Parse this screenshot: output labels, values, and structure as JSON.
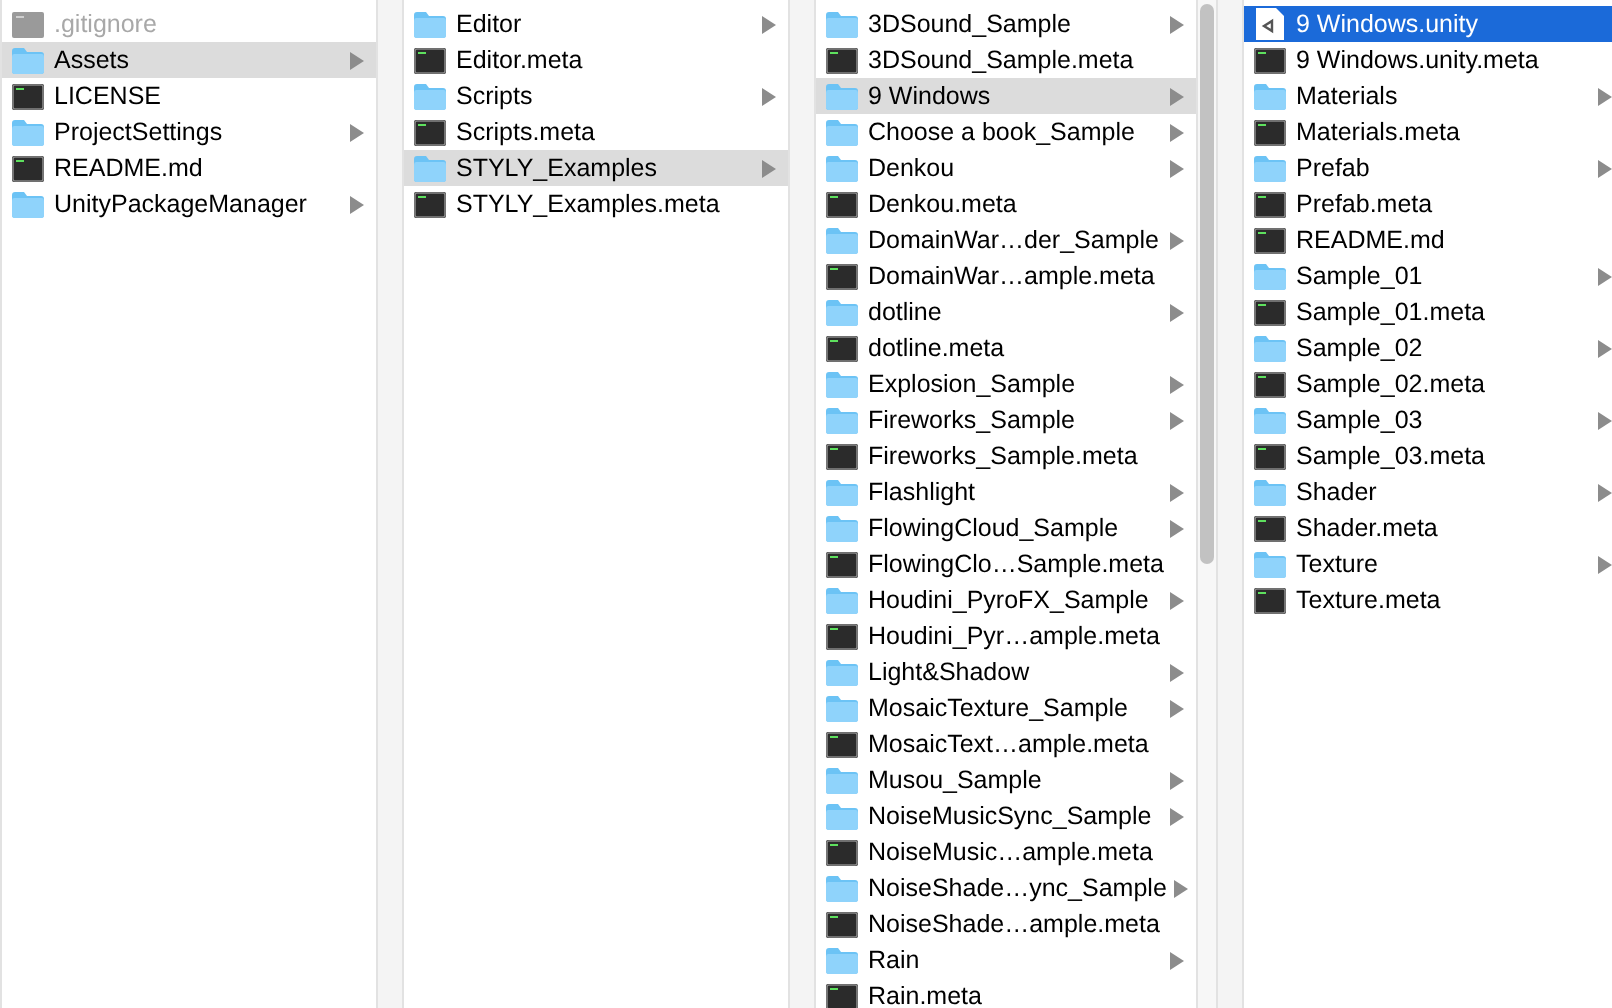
{
  "columns": [
    {
      "focused": false,
      "items": [
        {
          "name": ".gitignore",
          "kind": "hidden",
          "selected": false
        },
        {
          "name": "Assets",
          "kind": "folder",
          "selected": true
        },
        {
          "name": "LICENSE",
          "kind": "document",
          "selected": false
        },
        {
          "name": "ProjectSettings",
          "kind": "folder",
          "selected": false
        },
        {
          "name": "README.md",
          "kind": "document",
          "selected": false
        },
        {
          "name": "UnityPackageManager",
          "kind": "folder",
          "selected": false
        }
      ]
    },
    {
      "focused": false,
      "items": [
        {
          "name": "Editor",
          "kind": "folder",
          "selected": false
        },
        {
          "name": "Editor.meta",
          "kind": "document",
          "selected": false
        },
        {
          "name": "Scripts",
          "kind": "folder",
          "selected": false
        },
        {
          "name": "Scripts.meta",
          "kind": "document",
          "selected": false
        },
        {
          "name": "STYLY_Examples",
          "kind": "folder",
          "selected": true
        },
        {
          "name": "STYLY_Examples.meta",
          "kind": "document",
          "selected": false
        }
      ]
    },
    {
      "focused": false,
      "items": [
        {
          "name": "3DSound_Sample",
          "kind": "folder",
          "selected": false
        },
        {
          "name": "3DSound_Sample.meta",
          "kind": "document",
          "selected": false
        },
        {
          "name": "9 Windows",
          "kind": "folder",
          "selected": true
        },
        {
          "name": "Choose a book_Sample",
          "kind": "folder",
          "selected": false
        },
        {
          "name": "Denkou",
          "kind": "folder",
          "selected": false
        },
        {
          "name": "Denkou.meta",
          "kind": "document",
          "selected": false
        },
        {
          "name": "DomainWar…der_Sample",
          "kind": "folder",
          "selected": false
        },
        {
          "name": "DomainWar…ample.meta",
          "kind": "document",
          "selected": false
        },
        {
          "name": "dotline",
          "kind": "folder",
          "selected": false
        },
        {
          "name": "dotline.meta",
          "kind": "document",
          "selected": false
        },
        {
          "name": "Explosion_Sample",
          "kind": "folder",
          "selected": false
        },
        {
          "name": "Fireworks_Sample",
          "kind": "folder",
          "selected": false
        },
        {
          "name": "Fireworks_Sample.meta",
          "kind": "document",
          "selected": false
        },
        {
          "name": "Flashlight",
          "kind": "folder",
          "selected": false
        },
        {
          "name": "FlowingCloud_Sample",
          "kind": "folder",
          "selected": false
        },
        {
          "name": "FlowingClo…Sample.meta",
          "kind": "document",
          "selected": false
        },
        {
          "name": "Houdini_PyroFX_Sample",
          "kind": "folder",
          "selected": false
        },
        {
          "name": "Houdini_Pyr…ample.meta",
          "kind": "document",
          "selected": false
        },
        {
          "name": "Light&Shadow",
          "kind": "folder",
          "selected": false
        },
        {
          "name": "MosaicTexture_Sample",
          "kind": "folder",
          "selected": false
        },
        {
          "name": "MosaicText…ample.meta",
          "kind": "document",
          "selected": false
        },
        {
          "name": "Musou_Sample",
          "kind": "folder",
          "selected": false
        },
        {
          "name": "NoiseMusicSync_Sample",
          "kind": "folder",
          "selected": false
        },
        {
          "name": "NoiseMusic…ample.meta",
          "kind": "document",
          "selected": false
        },
        {
          "name": "NoiseShade…ync_Sample",
          "kind": "folder",
          "selected": false
        },
        {
          "name": "NoiseShade…ample.meta",
          "kind": "document",
          "selected": false
        },
        {
          "name": "Rain",
          "kind": "folder",
          "selected": false
        },
        {
          "name": "Rain.meta",
          "kind": "document",
          "selected": false
        }
      ]
    },
    {
      "focused": true,
      "items": [
        {
          "name": "9 Windows.unity",
          "kind": "unity",
          "selected": true
        },
        {
          "name": "9 Windows.unity.meta",
          "kind": "document",
          "selected": false
        },
        {
          "name": "Materials",
          "kind": "folder",
          "selected": false
        },
        {
          "name": "Materials.meta",
          "kind": "document",
          "selected": false
        },
        {
          "name": "Prefab",
          "kind": "folder",
          "selected": false
        },
        {
          "name": "Prefab.meta",
          "kind": "document",
          "selected": false
        },
        {
          "name": "README.md",
          "kind": "document",
          "selected": false
        },
        {
          "name": "Sample_01",
          "kind": "folder",
          "selected": false
        },
        {
          "name": "Sample_01.meta",
          "kind": "document",
          "selected": false
        },
        {
          "name": "Sample_02",
          "kind": "folder",
          "selected": false
        },
        {
          "name": "Sample_02.meta",
          "kind": "document",
          "selected": false
        },
        {
          "name": "Sample_03",
          "kind": "folder",
          "selected": false
        },
        {
          "name": "Sample_03.meta",
          "kind": "document",
          "selected": false
        },
        {
          "name": "Shader",
          "kind": "folder",
          "selected": false
        },
        {
          "name": "Shader.meta",
          "kind": "document",
          "selected": false
        },
        {
          "name": "Texture",
          "kind": "folder",
          "selected": false
        },
        {
          "name": "Texture.meta",
          "kind": "document",
          "selected": false
        }
      ]
    }
  ]
}
